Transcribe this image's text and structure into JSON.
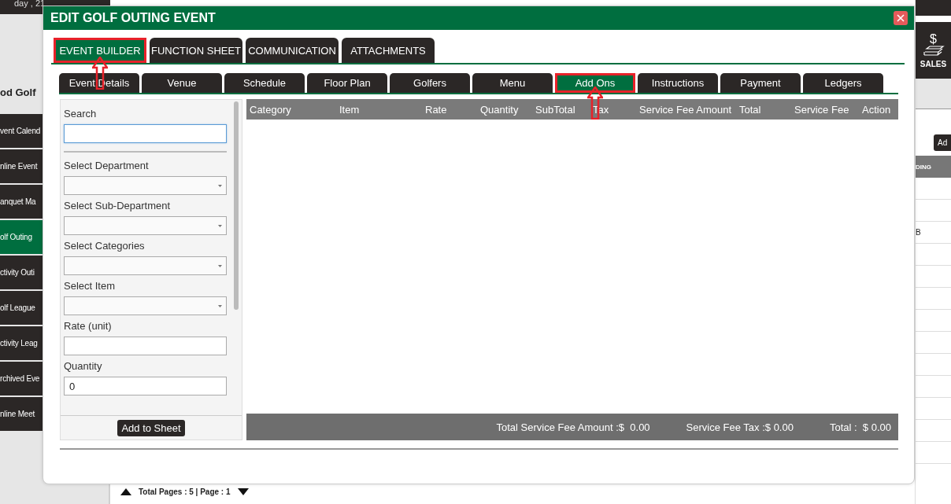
{
  "background": {
    "date_text": "day , 21",
    "heading": "od Golf",
    "sidebar_items": [
      {
        "label": "vent Calend",
        "selected": false
      },
      {
        "label": "nline Event",
        "selected": false
      },
      {
        "label": "anquet Ma",
        "selected": false
      },
      {
        "label": "olf Outing",
        "selected": true
      },
      {
        "label": "ctivity Outi",
        "selected": false
      },
      {
        "label": "olf League",
        "selected": false
      },
      {
        "label": "ctivity Leag",
        "selected": false
      },
      {
        "label": "rchived Eve",
        "selected": false
      },
      {
        "label": "nline Meet",
        "selected": false
      }
    ],
    "sales_tile": {
      "icon": "$",
      "label": "SALES"
    },
    "add_button": "Ad",
    "table_header": "DING",
    "table_cell": "B",
    "pagination": "Total Pages : 5 | Page : 1"
  },
  "dialog": {
    "title": "EDIT GOLF OUTING EVENT",
    "main_tabs": [
      {
        "label": "EVENT BUILDER",
        "selected": true,
        "annotated": true
      },
      {
        "label": "FUNCTION SHEET",
        "selected": false,
        "annotated": false
      },
      {
        "label": "COMMUNICATION",
        "selected": false,
        "annotated": false
      },
      {
        "label": "ATTACHMENTS",
        "selected": false,
        "annotated": false
      }
    ],
    "sub_tabs": [
      {
        "label": "Event Details",
        "selected": false,
        "annotated": false
      },
      {
        "label": "Venue",
        "selected": false,
        "annotated": false
      },
      {
        "label": "Schedule",
        "selected": false,
        "annotated": false
      },
      {
        "label": "Floor Plan",
        "selected": false,
        "annotated": false
      },
      {
        "label": "Golfers",
        "selected": false,
        "annotated": false
      },
      {
        "label": "Menu",
        "selected": false,
        "annotated": false
      },
      {
        "label": "Add Ons",
        "selected": true,
        "annotated": true
      },
      {
        "label": "Instructions",
        "selected": false,
        "annotated": false
      },
      {
        "label": "Payment",
        "selected": false,
        "annotated": false
      },
      {
        "label": "Ledgers",
        "selected": false,
        "annotated": false
      }
    ],
    "form": {
      "fields": [
        {
          "kind": "search",
          "label": "Search",
          "focused": true
        },
        {
          "kind": "select",
          "label": "Select Department",
          "focused": false
        },
        {
          "kind": "select",
          "label": "Select Sub-Department",
          "focused": false
        },
        {
          "kind": "select",
          "label": "Select Categories",
          "focused": false
        },
        {
          "kind": "select",
          "label": "Select Item",
          "focused": false
        },
        {
          "kind": "text",
          "label": "Rate (unit)",
          "focused": false
        },
        {
          "kind": "text",
          "label": "Quantity",
          "value": "0",
          "focused": false
        }
      ],
      "button": "Add to Sheet"
    },
    "grid": {
      "columns": [
        "Category",
        "Item",
        "Rate",
        "Quantity",
        "SubTotal",
        "Tax",
        "Service Fee Amount",
        "Total",
        "Service Fee",
        "Action"
      ],
      "totals": [
        "Total Service Fee Amount :$  0.00",
        "Service Fee Tax :$ 0.00",
        "Total :  $ 0.00"
      ]
    }
  }
}
